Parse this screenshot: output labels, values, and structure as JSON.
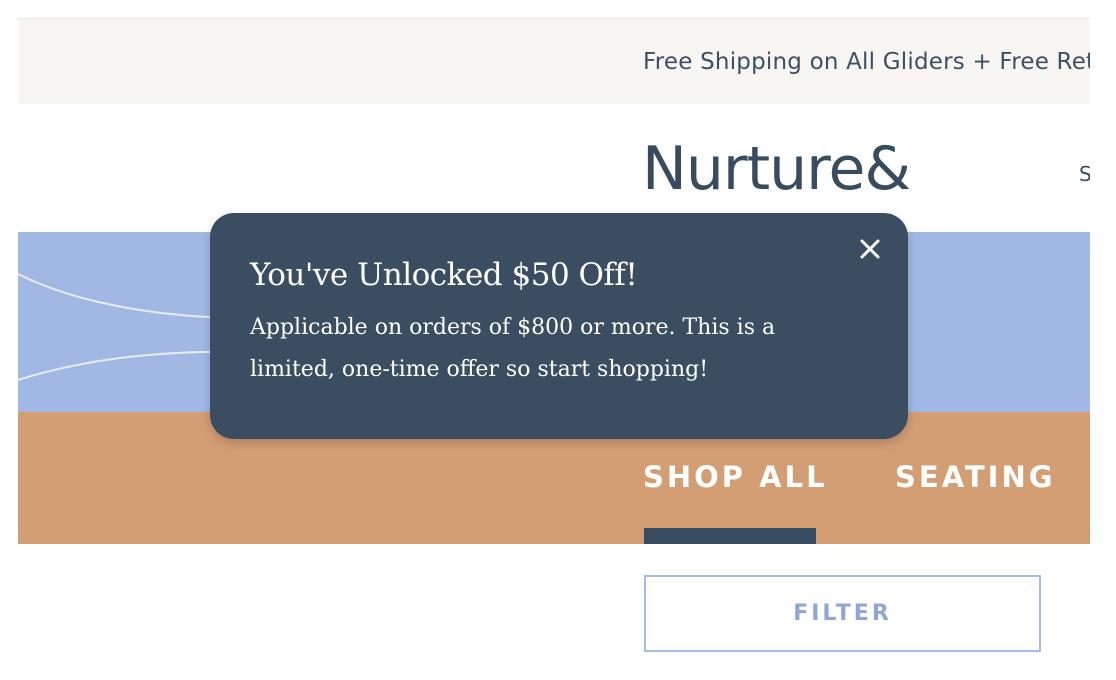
{
  "announcement": {
    "text": "Free Shipping on All Gliders + Free Ret"
  },
  "header": {
    "logo": "Nurture&",
    "nav_partial": "S"
  },
  "categories": {
    "tabs": [
      {
        "label": "SHOP ALL",
        "active": true
      },
      {
        "label": "SEATING",
        "active": false
      }
    ]
  },
  "filter": {
    "label": "FILTER"
  },
  "toast": {
    "title": "You've Unlocked $50 Off!",
    "body": "Applicable on orders of $800 or more. This is a limited, one-time offer so start shopping!",
    "close_icon": "close-icon"
  },
  "colors": {
    "navy": "#3a4d61",
    "sky_blue": "#a1b8e4",
    "tan": "#d39e74",
    "announcement_bg": "#f7f6f2",
    "filter_accent": "#8fa6d9"
  }
}
